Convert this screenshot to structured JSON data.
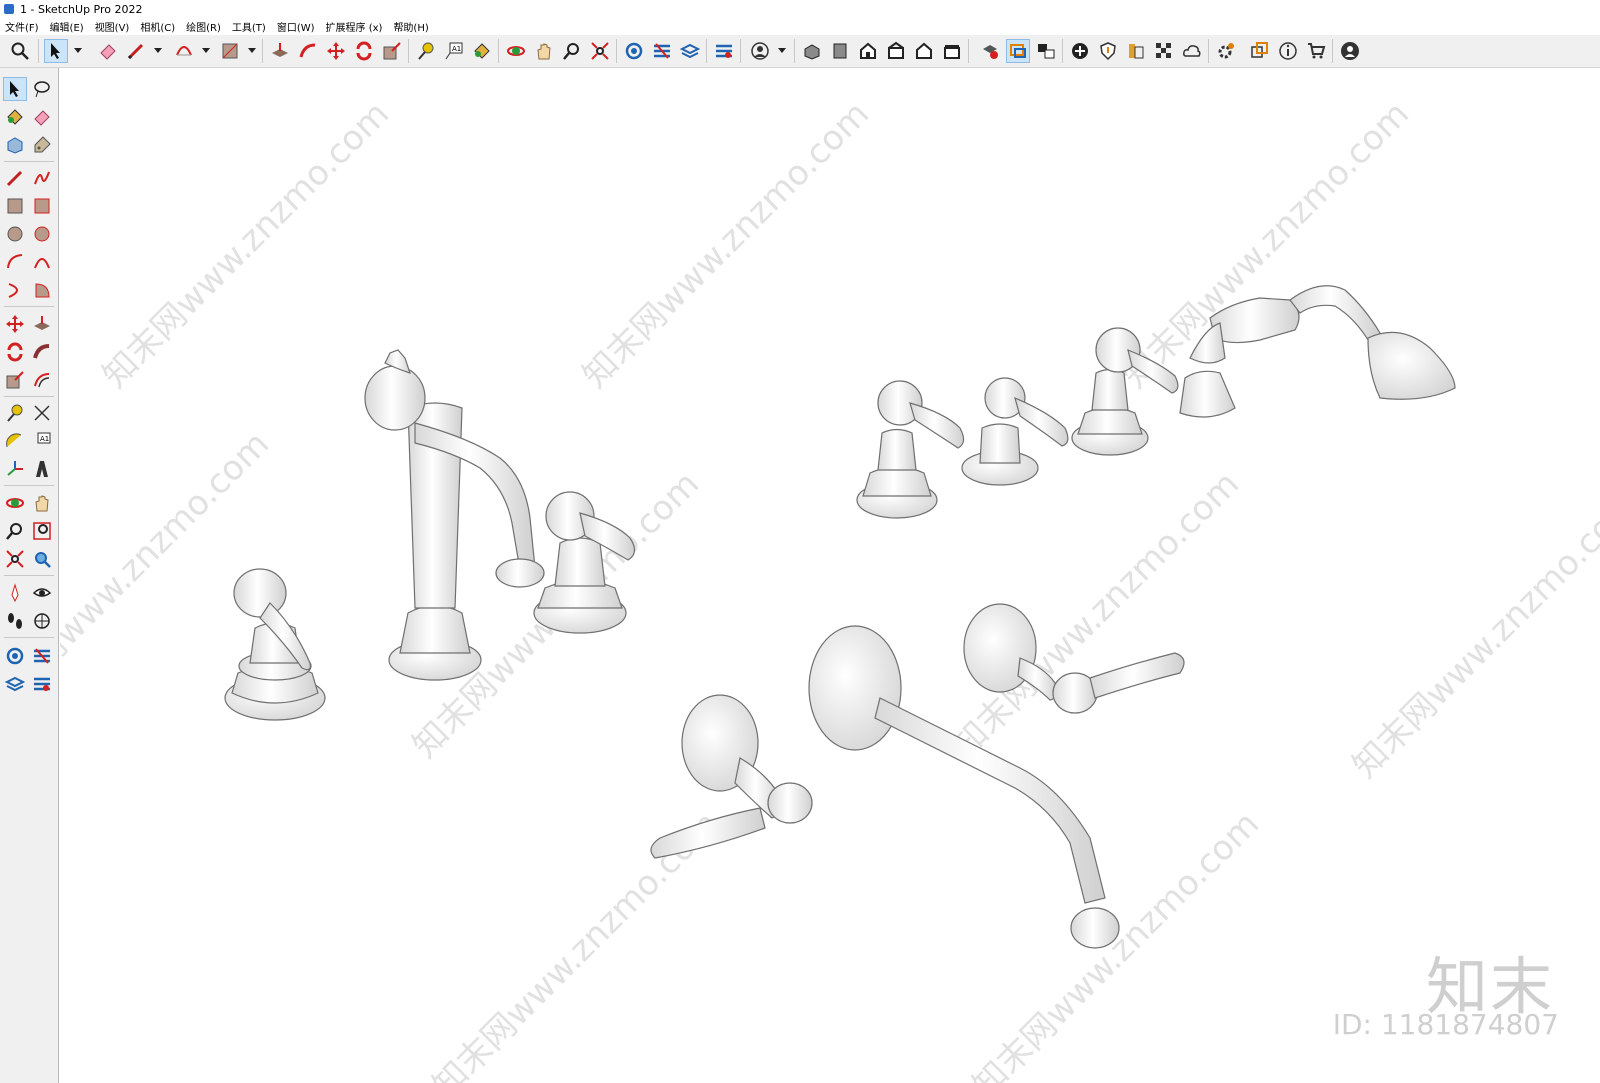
{
  "window": {
    "title": "1 - SketchUp Pro 2022"
  },
  "menu": [
    "文件(F)",
    "编辑(E)",
    "视图(V)",
    "相机(C)",
    "绘图(R)",
    "工具(T)",
    "窗口(W)",
    "扩展程序 (x)",
    "帮助(H)"
  ],
  "colors": {
    "toolbar_bg": "#f0f0f0",
    "active": "#cce4f7",
    "accent_red": "#d42020",
    "icon_blue": "#1f63b3"
  },
  "watermarks": [
    "知末网www.znzmo.com",
    "知末网www.znzmo.com",
    "知末网www.znzmo.com",
    "知末网www.znzmo.com",
    "知末网www.znzmo.com",
    "知末网www.znzmo.com",
    "知末网www.znzmo.com",
    "知末网www.znzmo.com",
    "知末网www.znzmo.com"
  ],
  "brand": {
    "name": "知末",
    "id": "ID: 1181874807"
  }
}
